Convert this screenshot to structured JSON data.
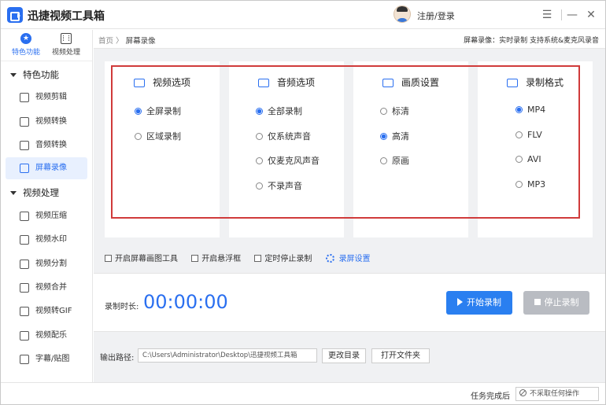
{
  "app": {
    "title": "迅捷视频工具箱",
    "login": "注册/登录"
  },
  "window_controls": {
    "menu": "☰",
    "minimize": "—",
    "close": "✕"
  },
  "sidebar": {
    "tabs": [
      {
        "label": "特色功能",
        "icon": "star-icon",
        "active": true
      },
      {
        "label": "视频处理",
        "icon": "film-icon",
        "active": false
      }
    ],
    "sections": [
      {
        "title": "特色功能",
        "items": [
          {
            "label": "视频剪辑",
            "icon": "scissors-icon"
          },
          {
            "label": "视频转换",
            "icon": "convert-icon"
          },
          {
            "label": "音频转换",
            "icon": "audio-icon"
          },
          {
            "label": "屏幕录像",
            "icon": "record-icon",
            "active": true
          }
        ]
      },
      {
        "title": "视频处理",
        "items": [
          {
            "label": "视频压缩",
            "icon": "compress-icon"
          },
          {
            "label": "视频水印",
            "icon": "watermark-icon"
          },
          {
            "label": "视频分割",
            "icon": "split-icon"
          },
          {
            "label": "视频合并",
            "icon": "merge-icon"
          },
          {
            "label": "视频转GIF",
            "icon": "gif-icon"
          },
          {
            "label": "视频配乐",
            "icon": "music-icon"
          },
          {
            "label": "字幕/贴图",
            "icon": "subtitle-icon"
          }
        ]
      }
    ]
  },
  "breadcrumb": {
    "home": "首页",
    "sep": "〉",
    "current": "屏幕录像"
  },
  "header_info": "屏幕录像：实时录制 支持系统&麦克风录音",
  "panels": [
    {
      "title": "视频选项",
      "icon": "video-icon",
      "options": [
        {
          "label": "全屏录制",
          "checked": true
        },
        {
          "label": "区域录制",
          "checked": false
        }
      ]
    },
    {
      "title": "音频选项",
      "icon": "audio-wave-icon",
      "options": [
        {
          "label": "全部录制",
          "checked": true
        },
        {
          "label": "仅系统声音",
          "checked": false
        },
        {
          "label": "仅麦克风声音",
          "checked": false
        },
        {
          "label": "不录声音",
          "checked": false
        }
      ]
    },
    {
      "title": "画质设置",
      "icon": "hd-icon",
      "options": [
        {
          "label": "标清",
          "checked": false
        },
        {
          "label": "高清",
          "checked": true
        },
        {
          "label": "原画",
          "checked": false
        }
      ]
    },
    {
      "title": "录制格式",
      "icon": "layers-icon",
      "options": [
        {
          "label": "MP4",
          "checked": true
        },
        {
          "label": "FLV",
          "checked": false
        },
        {
          "label": "AVI",
          "checked": false
        },
        {
          "label": "MP3",
          "checked": false
        }
      ]
    }
  ],
  "checkboxes": [
    {
      "label": "开启屏幕画图工具",
      "checked": false
    },
    {
      "label": "开启悬浮框",
      "checked": false
    },
    {
      "label": "定时停止录制",
      "checked": false
    }
  ],
  "settings_link": "录屏设置",
  "recording": {
    "label": "录制时长:",
    "time": "00:00:00",
    "start": "开始录制",
    "stop": "停止录制"
  },
  "output": {
    "label": "输出路径:",
    "path": "C:\\Users\\Administrator\\Desktop\\迅捷视频工具箱",
    "change_dir": "更改目录",
    "open_folder": "打开文件夹"
  },
  "status": {
    "label": "任务完成后",
    "select": "不采取任何操作"
  },
  "colors": {
    "accent": "#2a6ff0",
    "highlight_frame": "#d03b3b",
    "disabled": "#b9bcc2"
  }
}
